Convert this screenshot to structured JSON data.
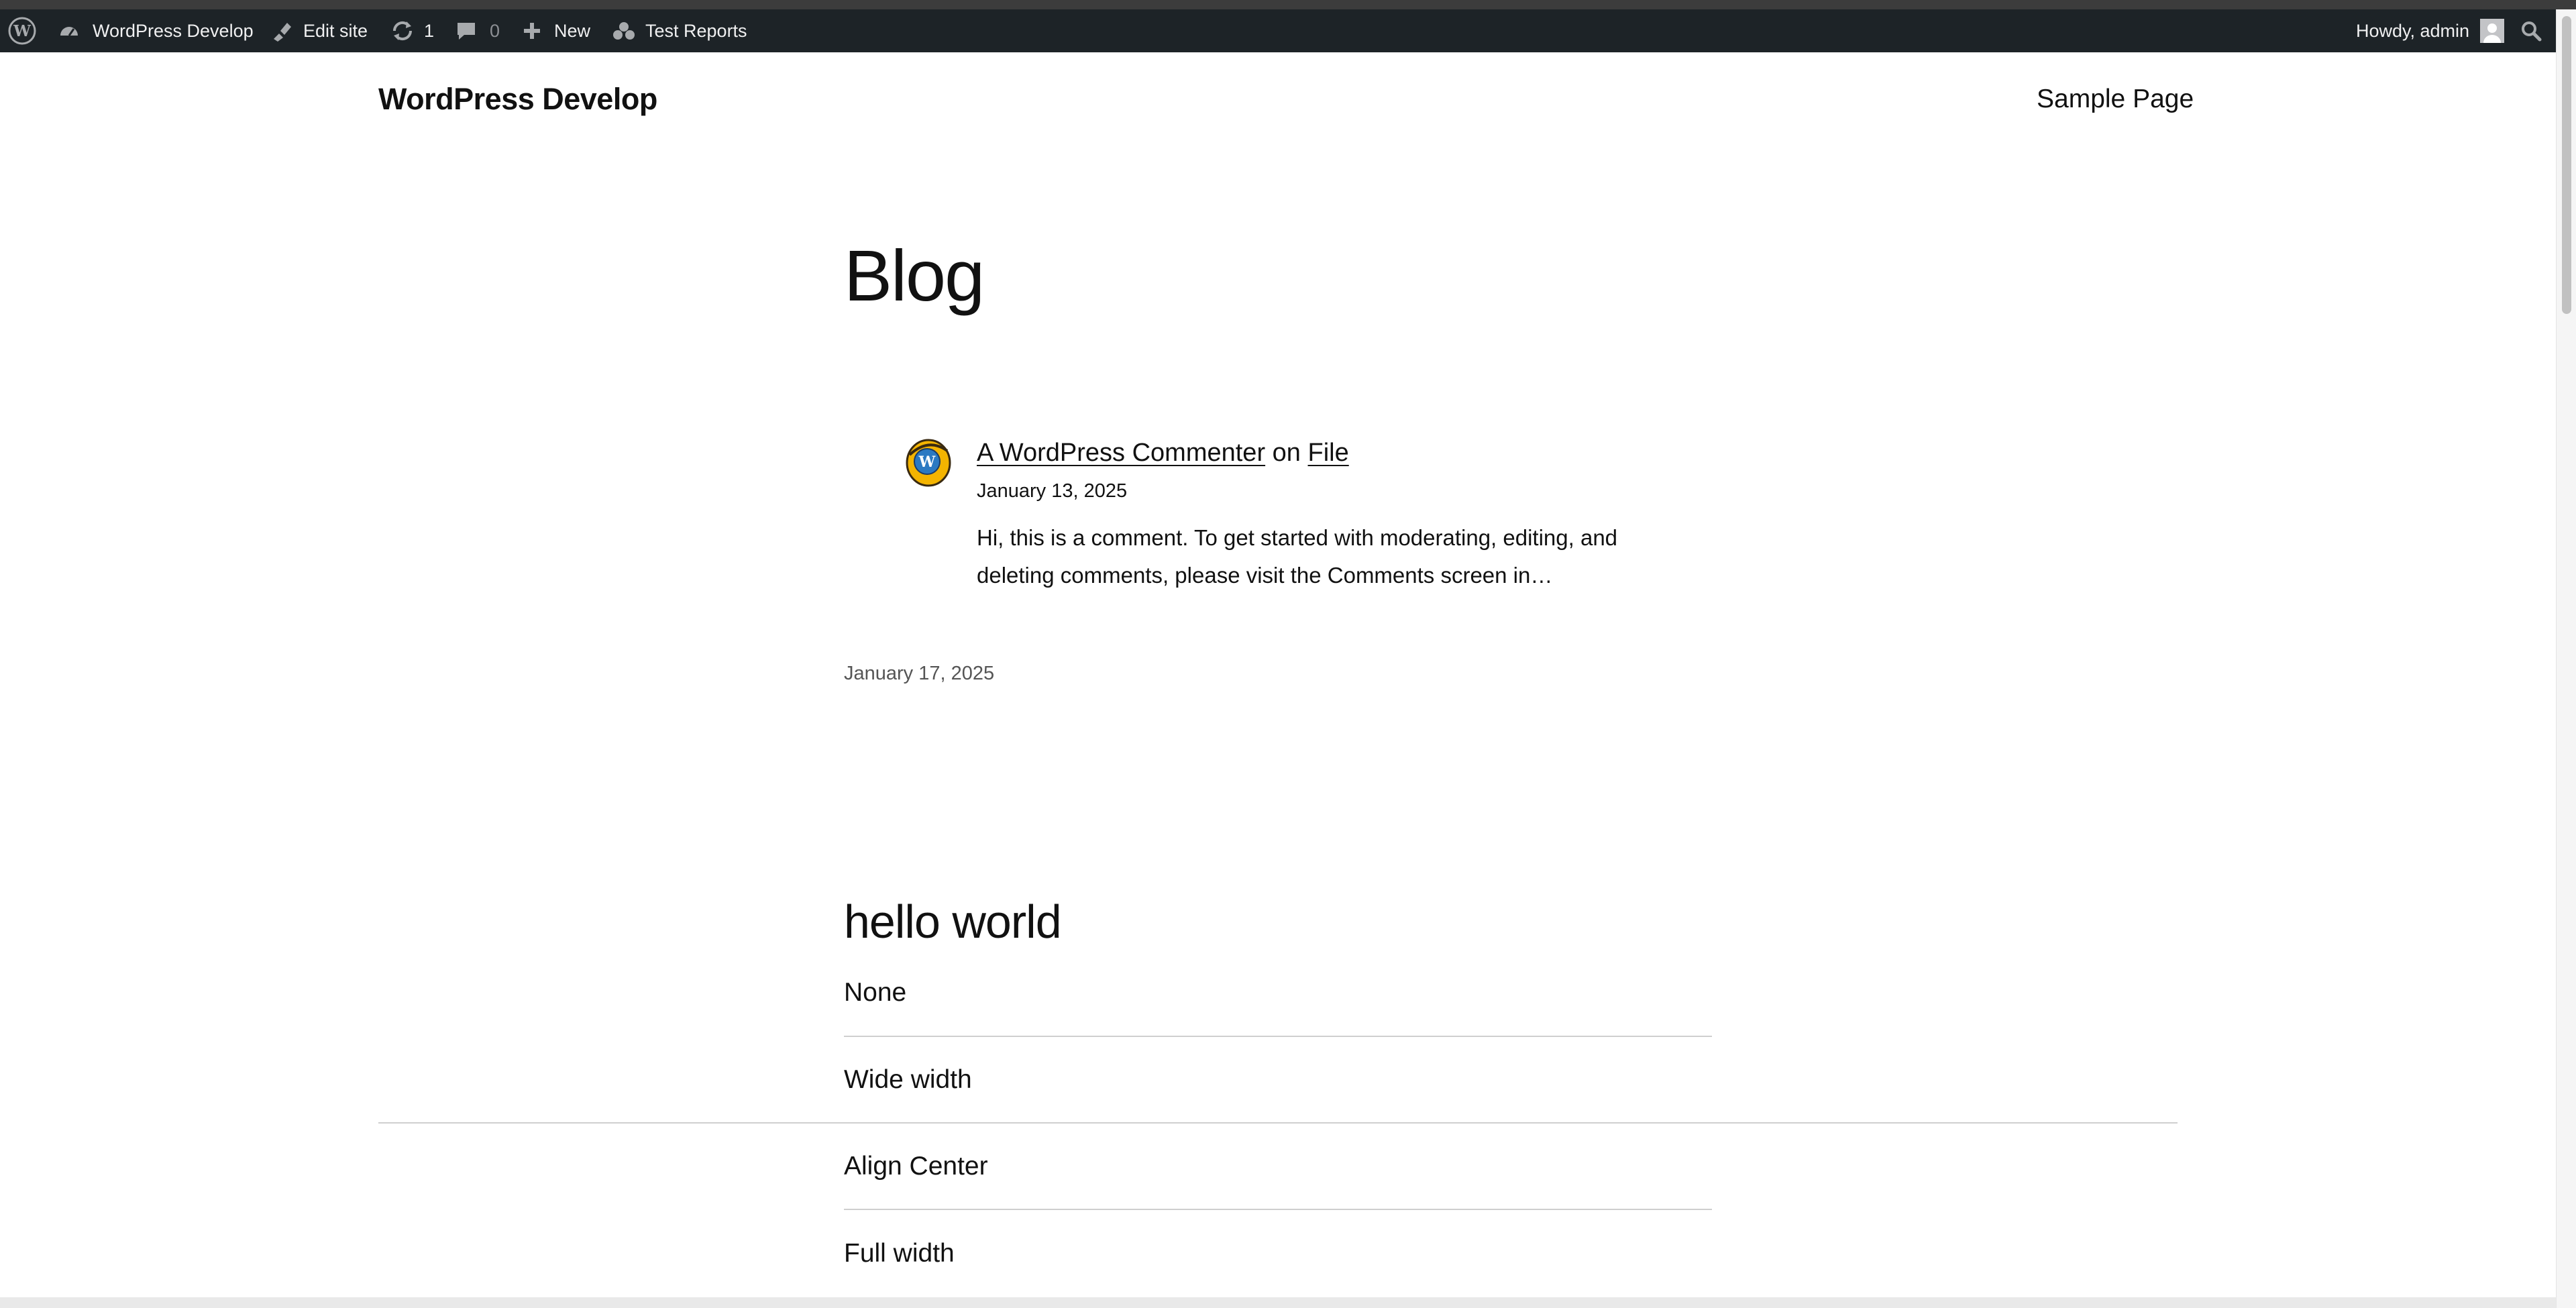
{
  "admin_bar": {
    "site_name": "WordPress Develop",
    "edit_site": "Edit site",
    "updates_count": "1",
    "comments_count": "0",
    "new_label": "New",
    "test_reports": "Test Reports",
    "greeting": "Howdy, admin",
    "icons": [
      "wordpress-logo-icon",
      "dashboard-icon",
      "edit-site-icon",
      "updates-icon",
      "comment-icon",
      "plus-icon",
      "test-reports-icon",
      "avatar-icon",
      "search-icon"
    ]
  },
  "site": {
    "title": "WordPress Develop",
    "nav": [
      "Sample Page"
    ]
  },
  "main": {
    "heading": "Blog",
    "comment": {
      "author": "A WordPress Commenter",
      "on": "on",
      "post": "File",
      "date": "January 13, 2025",
      "excerpt": "Hi, this is a comment. To get started with moderating, editing, and deleting comments, please visit the Comments screen in…"
    },
    "post_date": "January 17, 2025",
    "post": {
      "title": "hello world",
      "items": [
        "None",
        "Wide width",
        "Align Center",
        "Full width"
      ]
    }
  },
  "colors": {
    "admin_bar_bg": "#1d2327",
    "admin_bar_text": "#f0f0f1",
    "page_bg": "#ffffff",
    "text": "#111111",
    "separator": "#cfcfcf"
  }
}
